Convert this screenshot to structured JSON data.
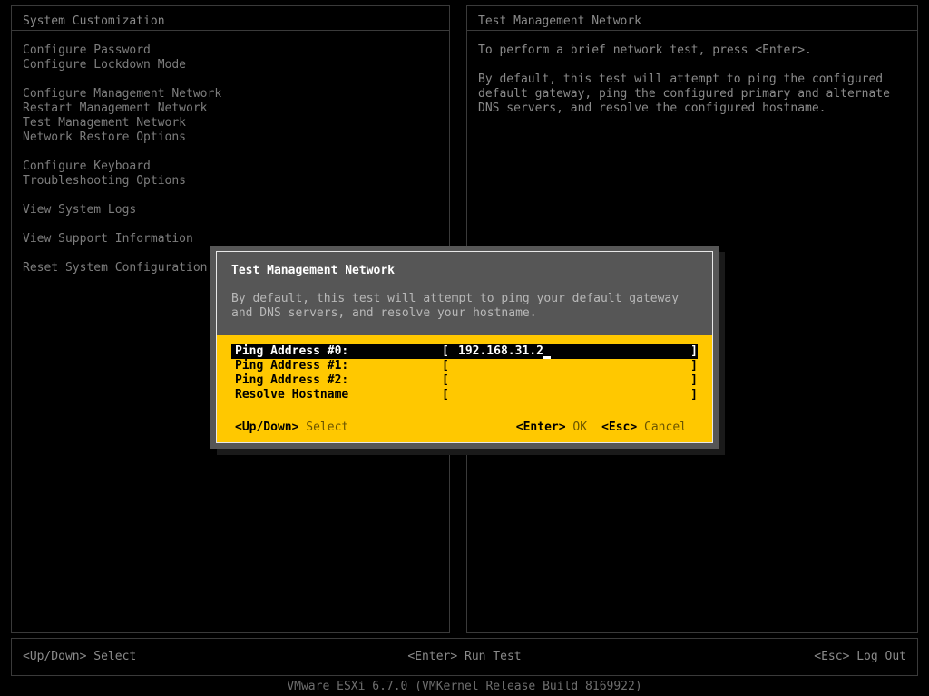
{
  "left_panel": {
    "title": "System Customization",
    "menu_groups": [
      {
        "items": [
          "Configure Password",
          "Configure Lockdown Mode"
        ]
      },
      {
        "items": [
          "Configure Management Network",
          "Restart Management Network",
          "Test Management Network",
          "Network Restore Options"
        ]
      },
      {
        "items": [
          "Configure Keyboard",
          "Troubleshooting Options"
        ]
      },
      {
        "items": [
          "View System Logs"
        ]
      },
      {
        "items": [
          "View Support Information"
        ]
      },
      {
        "items": [
          "Reset System Configuration"
        ]
      }
    ]
  },
  "right_panel": {
    "title": "Test Management Network",
    "paragraphs": [
      [
        "To perform a brief network test, press <Enter>."
      ],
      [
        "By default, this test will attempt to ping the configured",
        "default gateway, ping the configured primary and alternate",
        "DNS servers, and resolve the configured hostname."
      ]
    ]
  },
  "dialog": {
    "title": "Test Management Network",
    "subtext": [
      "By default, this test will attempt to ping your default gateway",
      "and DNS servers, and resolve your hostname."
    ],
    "fields": [
      {
        "label": "Ping Address #0:",
        "value": "192.168.31.2",
        "selected": true,
        "cursor": true
      },
      {
        "label": "Ping Address #1:",
        "value": "",
        "selected": false,
        "cursor": false
      },
      {
        "label": "Ping Address #2:",
        "value": "",
        "selected": false,
        "cursor": false
      },
      {
        "label": "Resolve Hostname",
        "value": "",
        "selected": false,
        "cursor": false
      }
    ],
    "bracket_open": "[",
    "bracket_close": "]",
    "hints": [
      {
        "key": "<Up/Down>",
        "action": "Select"
      },
      {
        "key": "<Enter>",
        "action": "OK"
      },
      {
        "key": "<Esc>",
        "action": "Cancel"
      }
    ]
  },
  "footer": {
    "hints": [
      {
        "key": "<Up/Down>",
        "action": "Select"
      },
      {
        "key": "<Enter>",
        "action": "Run Test"
      },
      {
        "key": "<Esc>",
        "action": "Log Out"
      }
    ],
    "hint_left": "<Up/Down> Select",
    "hint_center": "<Enter> Run Test",
    "hint_right": "<Esc> Log Out",
    "version": "VMware ESXi 6.7.0 (VMKernel Release Build 8169922)"
  },
  "colors": {
    "background": "#000000",
    "dialog_accent": "#FFC800",
    "dialog_header": "#565656",
    "dim_text": "#8a8a8a",
    "border": "#3a3a3a"
  }
}
